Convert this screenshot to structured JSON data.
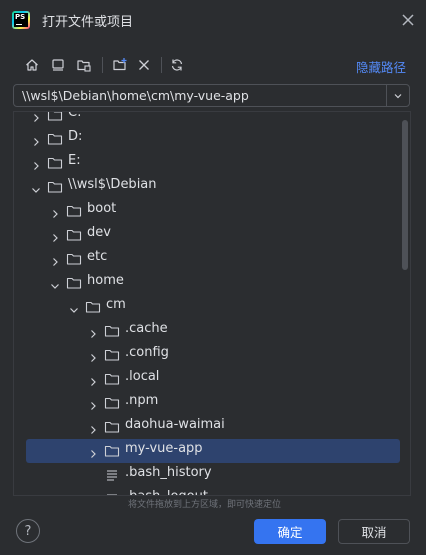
{
  "window": {
    "title": "打开文件或项目"
  },
  "toolbar": {
    "icons": [
      "home-icon",
      "desktop-icon",
      "project-folder-icon",
      "new-folder-icon",
      "delete-icon",
      "refresh-icon"
    ],
    "hide_path_label": "隐藏路径"
  },
  "path": {
    "value": "\\\\wsl$\\Debian\\home\\cm\\my-vue-app"
  },
  "tree": {
    "items": [
      {
        "label": "C:",
        "level": 0,
        "kind": "folder",
        "expanded": false
      },
      {
        "label": "D:",
        "level": 0,
        "kind": "folder",
        "expanded": false
      },
      {
        "label": "E:",
        "level": 0,
        "kind": "folder",
        "expanded": false
      },
      {
        "label": "\\\\wsl$\\Debian",
        "level": 0,
        "kind": "folder",
        "expanded": true
      },
      {
        "label": "boot",
        "level": 1,
        "kind": "folder",
        "expanded": false
      },
      {
        "label": "dev",
        "level": 1,
        "kind": "folder",
        "expanded": false
      },
      {
        "label": "etc",
        "level": 1,
        "kind": "folder",
        "expanded": false
      },
      {
        "label": "home",
        "level": 1,
        "kind": "folder",
        "expanded": true
      },
      {
        "label": "cm",
        "level": 2,
        "kind": "folder",
        "expanded": true
      },
      {
        "label": ".cache",
        "level": 3,
        "kind": "folder",
        "expanded": false
      },
      {
        "label": ".config",
        "level": 3,
        "kind": "folder",
        "expanded": false
      },
      {
        "label": ".local",
        "level": 3,
        "kind": "folder",
        "expanded": false
      },
      {
        "label": ".npm",
        "level": 3,
        "kind": "folder",
        "expanded": false
      },
      {
        "label": "daohua-waimai",
        "level": 3,
        "kind": "folder",
        "expanded": false
      },
      {
        "label": "my-vue-app",
        "level": 3,
        "kind": "folder",
        "expanded": false,
        "selected": true
      },
      {
        "label": ".bash_history",
        "level": 3,
        "kind": "file"
      },
      {
        "label": ".bash_logout",
        "level": 3,
        "kind": "file"
      }
    ]
  },
  "hint": "将文件拖放到上方区域，即可快速定位",
  "footer": {
    "help_label": "?",
    "ok_label": "确定",
    "cancel_label": "取消"
  },
  "colors": {
    "background": "#2b2d30",
    "selection": "#2e436e",
    "accent": "#3574f0",
    "link": "#548af7",
    "text": "#dfe1e5"
  }
}
